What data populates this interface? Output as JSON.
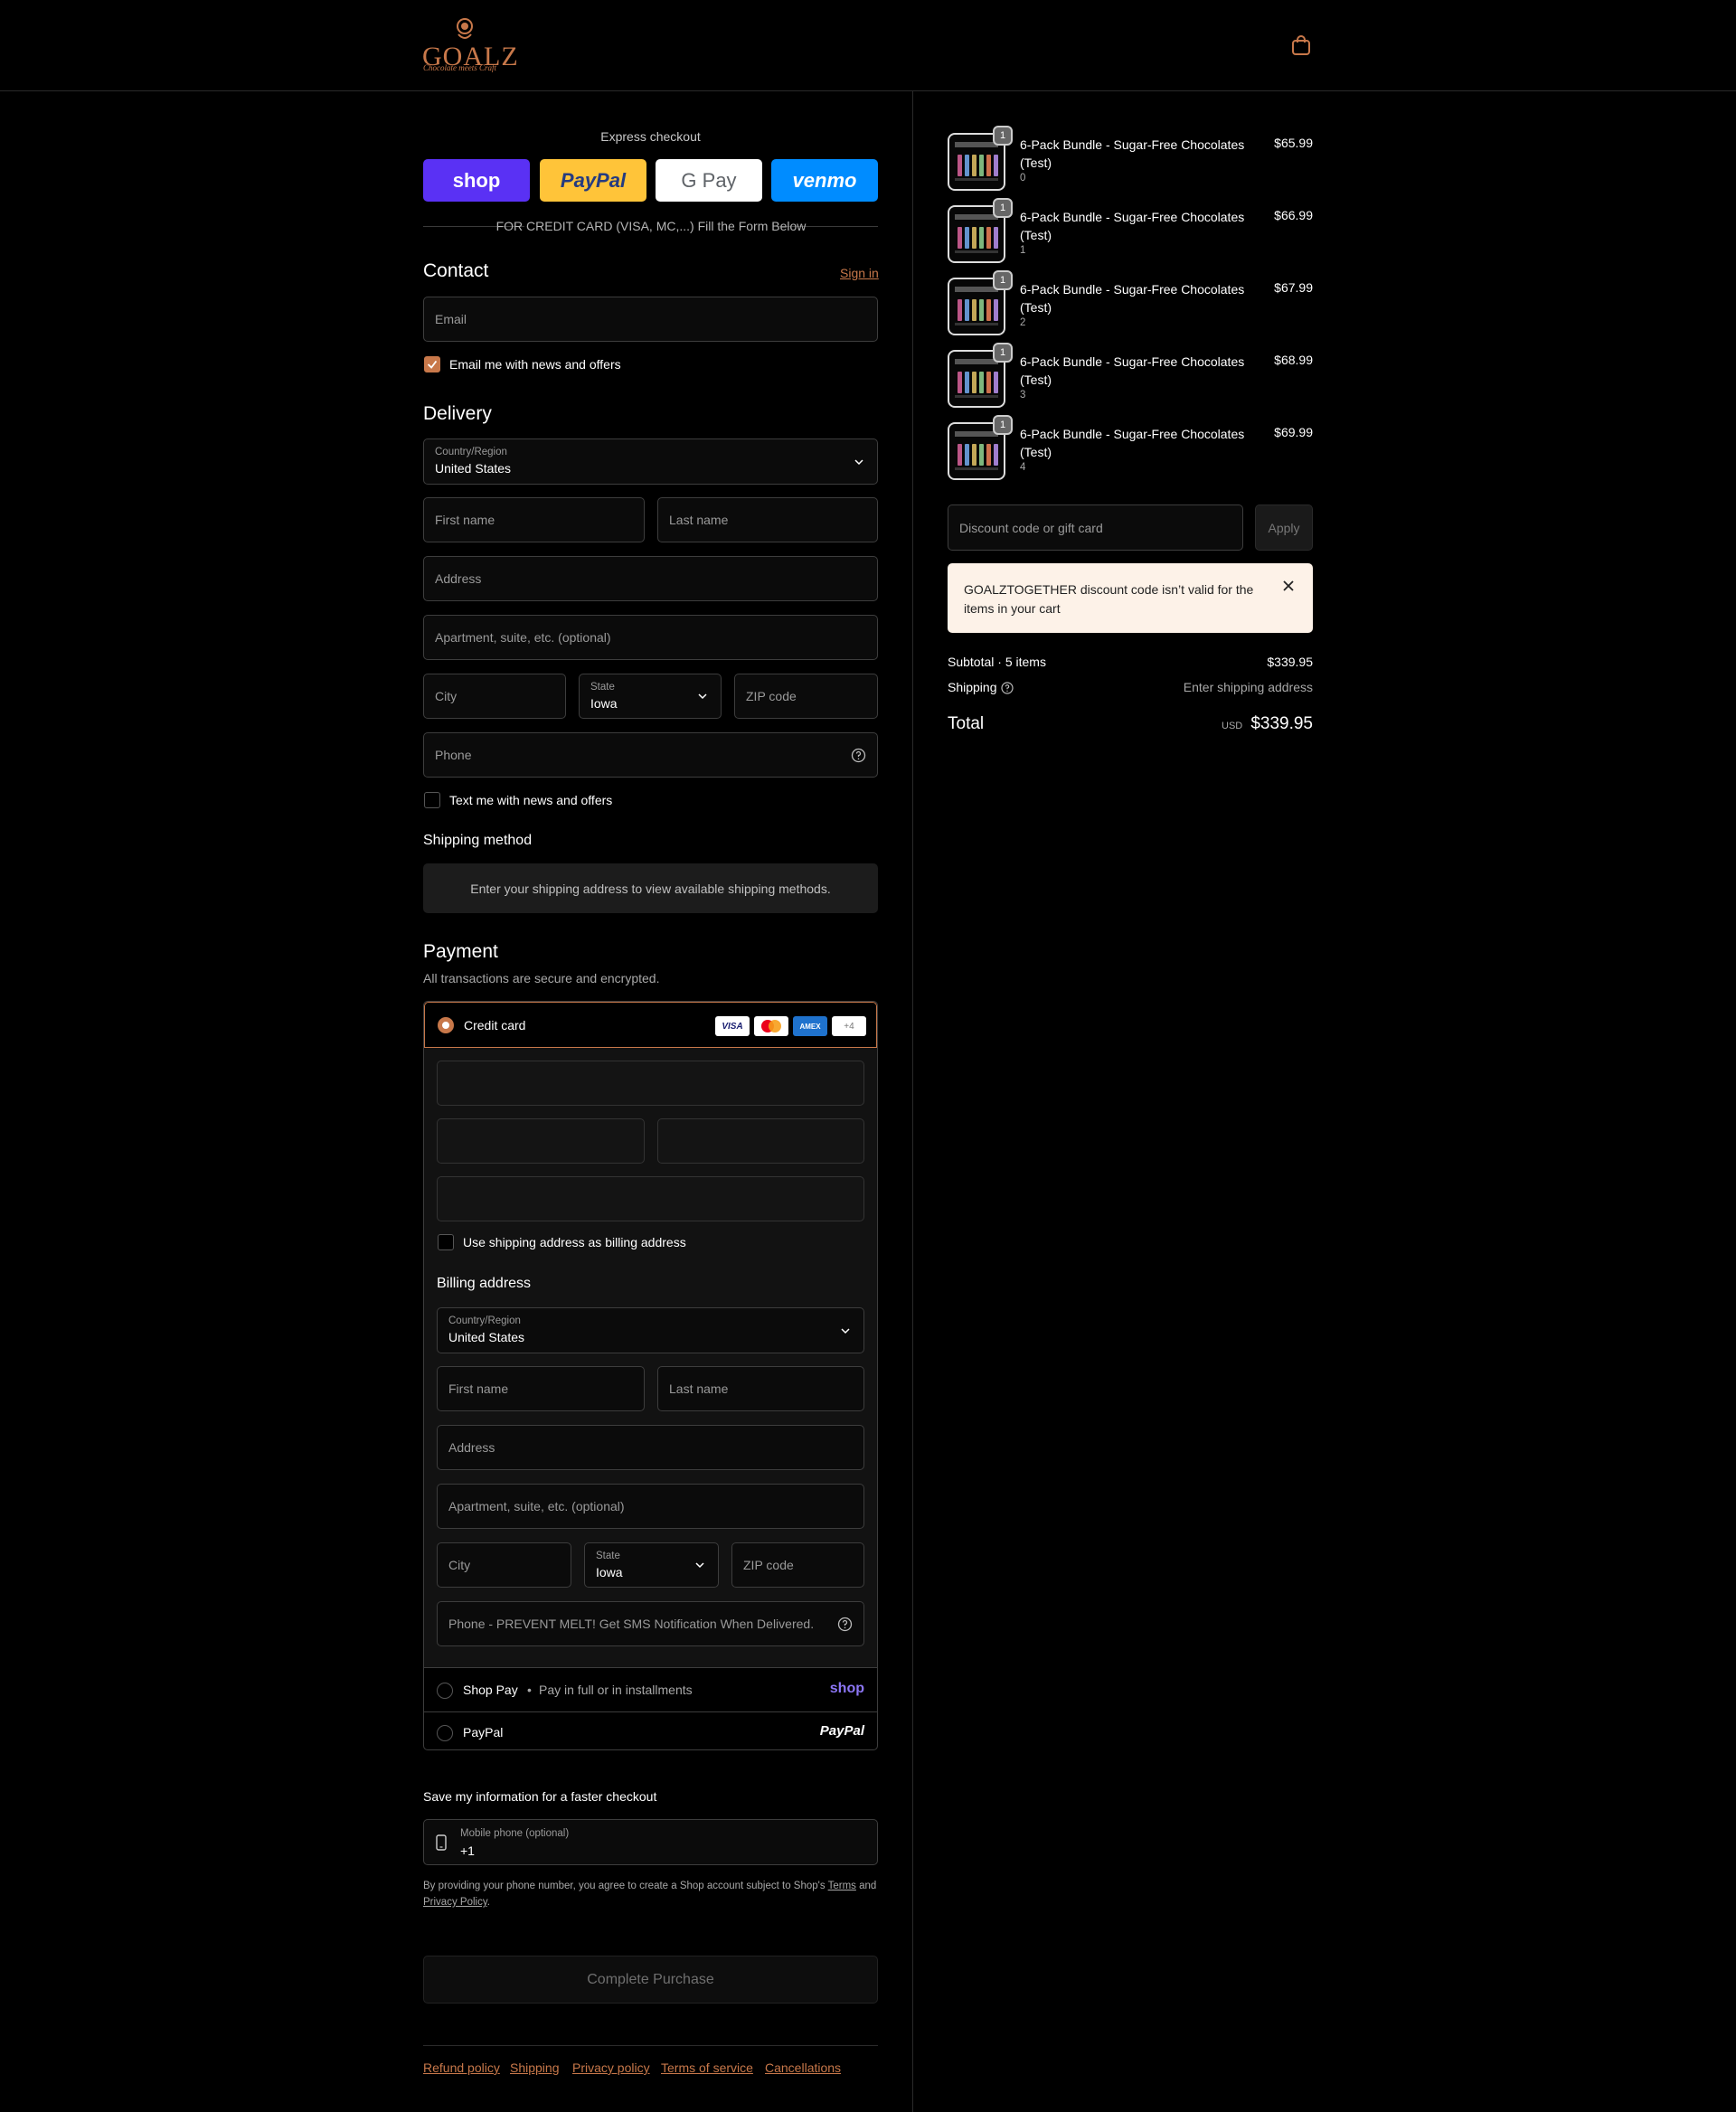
{
  "brand": {
    "logo_text": "GOALZ",
    "logo_tagline": "Chocolate meets Craft",
    "accent_color": "#c8784a"
  },
  "header": {
    "cart_icon": "shopping-bag-icon"
  },
  "express": {
    "title": "Express checkout",
    "buttons": [
      {
        "label": "shop",
        "color": "#5a31f4"
      },
      {
        "label": "PayPal",
        "color": "#ffc439"
      },
      {
        "label": "G Pay",
        "color": "#ffffff"
      },
      {
        "label": "venmo",
        "color": "#008cff"
      }
    ],
    "divider_text": "FOR CREDIT CARD (VISA, MC,...) Fill the Form Below"
  },
  "contact": {
    "title": "Contact",
    "sign_in": "Sign in",
    "email_placeholder": "Email",
    "email_news": "Email me with news and offers"
  },
  "delivery": {
    "title": "Delivery",
    "country_label": "Country/Region",
    "country_value": "United States",
    "first_name": "First name",
    "last_name": "Last name",
    "address": "Address",
    "apartment": "Apartment, suite, etc. (optional)",
    "city": "City",
    "state_label": "State",
    "state_value": "Iowa",
    "zip": "ZIP code",
    "phone": "Phone",
    "text_news": "Text me with news and offers"
  },
  "shipping_method": {
    "title": "Shipping method",
    "info": "Enter your shipping address to view available shipping methods."
  },
  "payment": {
    "title": "Payment",
    "subtitle": "All transactions are secure and encrypted.",
    "credit_card": "Credit card",
    "card_badges": [
      "VISA",
      "MC",
      "AMEX",
      "+4"
    ],
    "use_shipping": "Use shipping address as billing address",
    "billing_title": "Billing address",
    "billing": {
      "country_label": "Country/Region",
      "country_value": "United States",
      "first_name": "First name",
      "last_name": "Last name",
      "address": "Address",
      "apartment": "Apartment, suite, etc. (optional)",
      "city": "City",
      "state_label": "State",
      "state_value": "Iowa",
      "zip": "ZIP code",
      "phone": "Phone - PREVENT MELT! Get SMS Notification When Delivered."
    },
    "shop_pay": "Shop Pay",
    "shop_pay_sub": "Pay in full or in installments",
    "shop_pay_logo": "shop",
    "paypal": "PayPal",
    "paypal_logo": "PayPal"
  },
  "save_info": {
    "title": "Save my information for a faster checkout",
    "mobile_label": "Mobile phone (optional)",
    "mobile_value": "+1",
    "legal_text": "By providing your phone number, you agree to create a Shop account subject to Shop's",
    "terms": "Terms",
    "and": "and",
    "privacy": "Privacy Policy",
    "period": "."
  },
  "complete_button": "Complete Purchase",
  "footer_links": [
    "Refund policy",
    "Shipping",
    "Privacy policy",
    "Terms of service",
    "Cancellations"
  ],
  "cart": {
    "items": [
      {
        "qty": "1",
        "name": "6-Pack Bundle - Sugar-Free Chocolates (Test)",
        "variant": "0",
        "price": "$65.99"
      },
      {
        "qty": "1",
        "name": "6-Pack Bundle - Sugar-Free Chocolates (Test)",
        "variant": "1",
        "price": "$66.99"
      },
      {
        "qty": "1",
        "name": "6-Pack Bundle - Sugar-Free Chocolates (Test)",
        "variant": "2",
        "price": "$67.99"
      },
      {
        "qty": "1",
        "name": "6-Pack Bundle - Sugar-Free Chocolates (Test)",
        "variant": "3",
        "price": "$68.99"
      },
      {
        "qty": "1",
        "name": "6-Pack Bundle - Sugar-Free Chocolates (Test)",
        "variant": "4",
        "price": "$69.99"
      }
    ],
    "discount_placeholder": "Discount code or gift card",
    "apply": "Apply",
    "error": "GOALZTOGETHER discount code isn’t valid for the items in your cart",
    "subtotal_label": "Subtotal · 5 items",
    "subtotal_value": "$339.95",
    "shipping_label": "Shipping",
    "shipping_value": "Enter shipping address",
    "total_label": "Total",
    "currency": "USD",
    "total_value": "$339.95"
  }
}
